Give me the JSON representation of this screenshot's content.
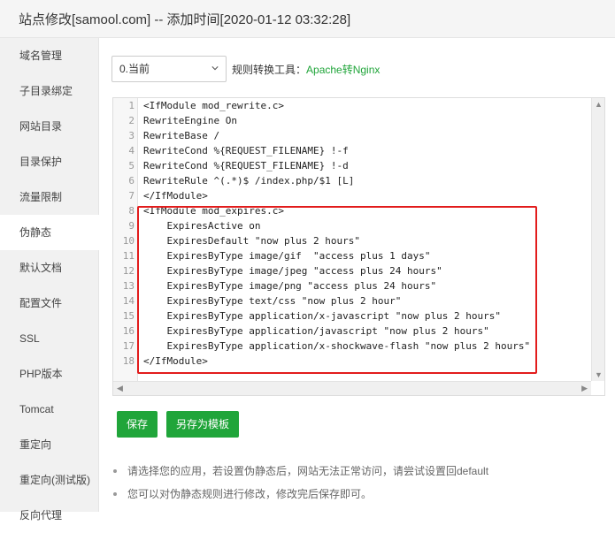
{
  "window": {
    "title": "站点修改[samool.com] -- 添加时间[2020-01-12 03:32:28]"
  },
  "sidebar": {
    "items": [
      {
        "label": "域名管理"
      },
      {
        "label": "子目录绑定"
      },
      {
        "label": "网站目录"
      },
      {
        "label": "目录保护"
      },
      {
        "label": "流量限制"
      },
      {
        "label": "伪静态",
        "active": true
      },
      {
        "label": "默认文档"
      },
      {
        "label": "配置文件"
      },
      {
        "label": "SSL"
      },
      {
        "label": "PHP版本"
      },
      {
        "label": "Tomcat"
      },
      {
        "label": "重定向"
      },
      {
        "label": "重定向(测试版)"
      },
      {
        "label": "反向代理"
      }
    ]
  },
  "rewrite": {
    "select_value": "0.当前",
    "tool_label": "规则转换工具：",
    "tool_link": "Apache转Nginx"
  },
  "editor": {
    "line_numbers": [
      "1",
      "2",
      "3",
      "4",
      "5",
      "6",
      "7",
      "8",
      "9",
      "10",
      "11",
      "12",
      "13",
      "14",
      "15",
      "16",
      "17",
      "18"
    ],
    "lines": [
      "<IfModule mod_rewrite.c>",
      "RewriteEngine On",
      "RewriteBase /",
      "RewriteCond %{REQUEST_FILENAME} !-f",
      "RewriteCond %{REQUEST_FILENAME} !-d",
      "RewriteRule ^(.*)$ /index.php/$1 [L]",
      "</IfModule>",
      "<IfModule mod_expires.c>",
      "    ExpiresActive on",
      "    ExpiresDefault \"now plus 2 hours\"",
      "    ExpiresByType image/gif  \"access plus 1 days\"",
      "    ExpiresByType image/jpeg \"access plus 24 hours\"",
      "    ExpiresByType image/png \"access plus 24 hours\"",
      "    ExpiresByType text/css \"now plus 2 hour\"",
      "    ExpiresByType application/x-javascript \"now plus 2 hours\"",
      "    ExpiresByType application/javascript \"now plus 2 hours\"",
      "    ExpiresByType application/x-shockwave-flash \"now plus 2 hours\"",
      "</IfModule>"
    ]
  },
  "buttons": {
    "save": "保存",
    "save_template": "另存为模板"
  },
  "tips": [
    "请选择您的应用，若设置伪静态后，网站无法正常访问，请尝试设置回default",
    "您可以对伪静态规则进行修改，修改完后保存即可。"
  ],
  "colors": {
    "accent": "#20a53a",
    "highlight": "#e21c1c"
  }
}
